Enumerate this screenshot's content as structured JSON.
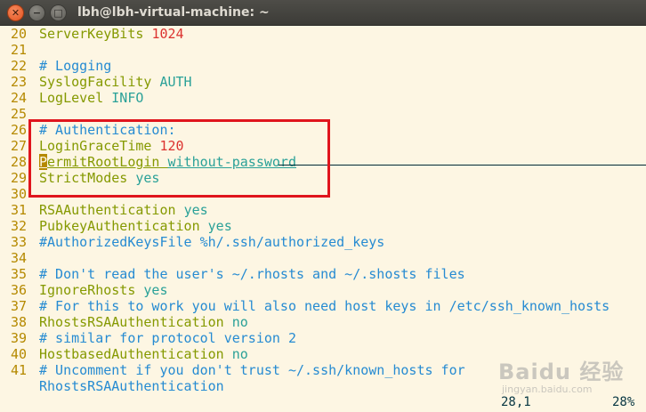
{
  "window": {
    "title": "lbh@lbh-virtual-machine: ~"
  },
  "editor": {
    "lines": [
      {
        "n": "20",
        "parts": [
          {
            "t": "ServerKeyBits ",
            "c": "kw"
          },
          {
            "t": "1024",
            "c": "num"
          }
        ]
      },
      {
        "n": "21",
        "parts": []
      },
      {
        "n": "22",
        "parts": [
          {
            "t": "# Logging",
            "c": "comment"
          }
        ]
      },
      {
        "n": "23",
        "parts": [
          {
            "t": "SyslogFacility ",
            "c": "kw"
          },
          {
            "t": "AUTH",
            "c": "str"
          }
        ]
      },
      {
        "n": "24",
        "parts": [
          {
            "t": "LogLevel ",
            "c": "kw"
          },
          {
            "t": "INFO",
            "c": "str"
          }
        ]
      },
      {
        "n": "25",
        "parts": []
      },
      {
        "n": "26",
        "parts": [
          {
            "t": "# Authentication:",
            "c": "comment"
          }
        ]
      },
      {
        "n": "27",
        "parts": [
          {
            "t": "LoginGraceTime ",
            "c": "kw"
          },
          {
            "t": "120",
            "c": "num"
          }
        ]
      },
      {
        "n": "28",
        "parts": [
          {
            "t": "P",
            "c": "kw cursor underline"
          },
          {
            "t": "ermitRootLogin ",
            "c": "kw underline"
          },
          {
            "t": "without-password",
            "c": "str underline"
          }
        ]
      },
      {
        "n": "29",
        "parts": [
          {
            "t": "StrictModes ",
            "c": "kw"
          },
          {
            "t": "yes",
            "c": "str"
          }
        ]
      },
      {
        "n": "30",
        "parts": []
      },
      {
        "n": "31",
        "parts": [
          {
            "t": "RSAAuthentication ",
            "c": "kw"
          },
          {
            "t": "yes",
            "c": "str"
          }
        ]
      },
      {
        "n": "32",
        "parts": [
          {
            "t": "PubkeyAuthentication ",
            "c": "kw"
          },
          {
            "t": "yes",
            "c": "str"
          }
        ]
      },
      {
        "n": "33",
        "parts": [
          {
            "t": "#AuthorizedKeysFile %h/.ssh/authorized_keys",
            "c": "comment"
          }
        ]
      },
      {
        "n": "34",
        "parts": []
      },
      {
        "n": "35",
        "parts": [
          {
            "t": "# Don't read the user's ~/.rhosts and ~/.shosts files",
            "c": "comment"
          }
        ]
      },
      {
        "n": "36",
        "parts": [
          {
            "t": "IgnoreRhosts ",
            "c": "kw"
          },
          {
            "t": "yes",
            "c": "str"
          }
        ]
      },
      {
        "n": "37",
        "parts": [
          {
            "t": "# For this to work you will also need host keys in /etc/ssh_known_hosts",
            "c": "comment"
          }
        ]
      },
      {
        "n": "38",
        "parts": [
          {
            "t": "RhostsRSAAuthentication ",
            "c": "kw"
          },
          {
            "t": "no",
            "c": "str"
          }
        ]
      },
      {
        "n": "39",
        "parts": [
          {
            "t": "# similar for protocol version 2",
            "c": "comment"
          }
        ]
      },
      {
        "n": "40",
        "parts": [
          {
            "t": "HostbasedAuthentication ",
            "c": "kw"
          },
          {
            "t": "no",
            "c": "str"
          }
        ]
      },
      {
        "n": "41",
        "parts": [
          {
            "t": "# Uncomment if you don't trust ~/.ssh/known_hosts for",
            "c": "comment"
          }
        ]
      },
      {
        "n": "",
        "parts": [
          {
            "t": "RhostsRSAAuthentication",
            "c": "comment"
          }
        ]
      }
    ]
  },
  "status": {
    "position": "28,1",
    "percent": "28%"
  },
  "watermark": {
    "brand": "Baidu 经验",
    "site": "jingyan.baidu.com"
  }
}
